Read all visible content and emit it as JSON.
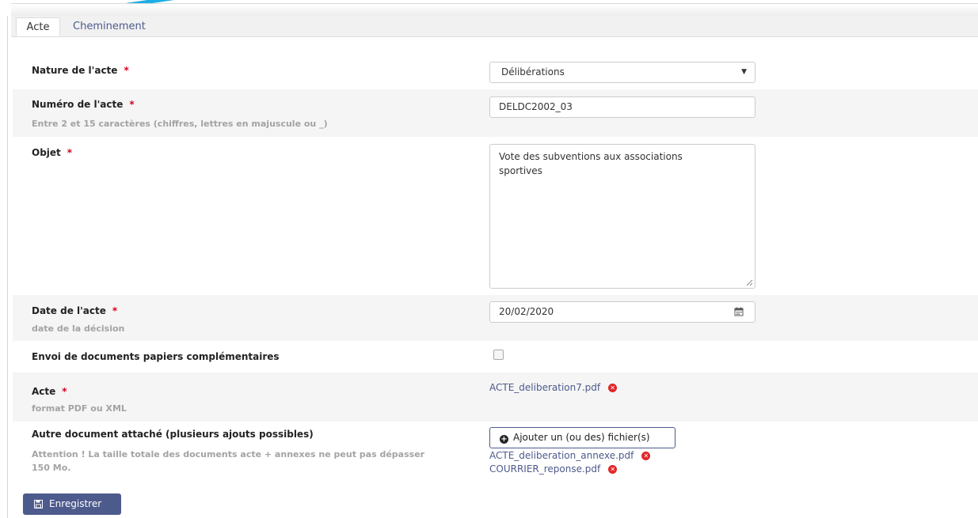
{
  "tabs": [
    {
      "label": "Acte",
      "active": true
    },
    {
      "label": "Cheminement",
      "active": false
    }
  ],
  "form": {
    "nature": {
      "label": "Nature de l'acte",
      "required_mark": "*",
      "value": "Délibérations"
    },
    "numero": {
      "label": "Numéro de l'acte",
      "required_mark": "*",
      "help": "Entre 2 et 15 caractères (chiffres, lettres en majuscule ou _)",
      "value": "DELDC2002_03"
    },
    "objet": {
      "label": "Objet",
      "required_mark": "*",
      "value": "Vote des subventions aux associations sportives"
    },
    "date": {
      "label": "Date de l'acte",
      "required_mark": "*",
      "help": "date de la décision",
      "value": "20/02/2020"
    },
    "envoi": {
      "label": "Envoi de documents papiers complémentaires",
      "checked": false
    },
    "acte": {
      "label": "Acte",
      "required_mark": "*",
      "help": "format PDF ou XML",
      "file": "ACTE_deliberation7.pdf"
    },
    "autre": {
      "label": "Autre document attaché (plusieurs ajouts possibles)",
      "help_line1": "Attention ! La taille totale des documents acte + annexes ne peut pas dépasser",
      "help_line2": "150 Mo.",
      "add_button": "Ajouter un (ou des) fichier(s)",
      "files": [
        "ACTE_deliberation_annexe.pdf",
        "COURRIER_reponse.pdf"
      ]
    }
  },
  "save_button": "Enregistrer",
  "colors": {
    "accent": "#4d5a8c",
    "required": "#d9001b",
    "remove": "#e0262a",
    "annotation_arrow": "#1eaee6"
  }
}
